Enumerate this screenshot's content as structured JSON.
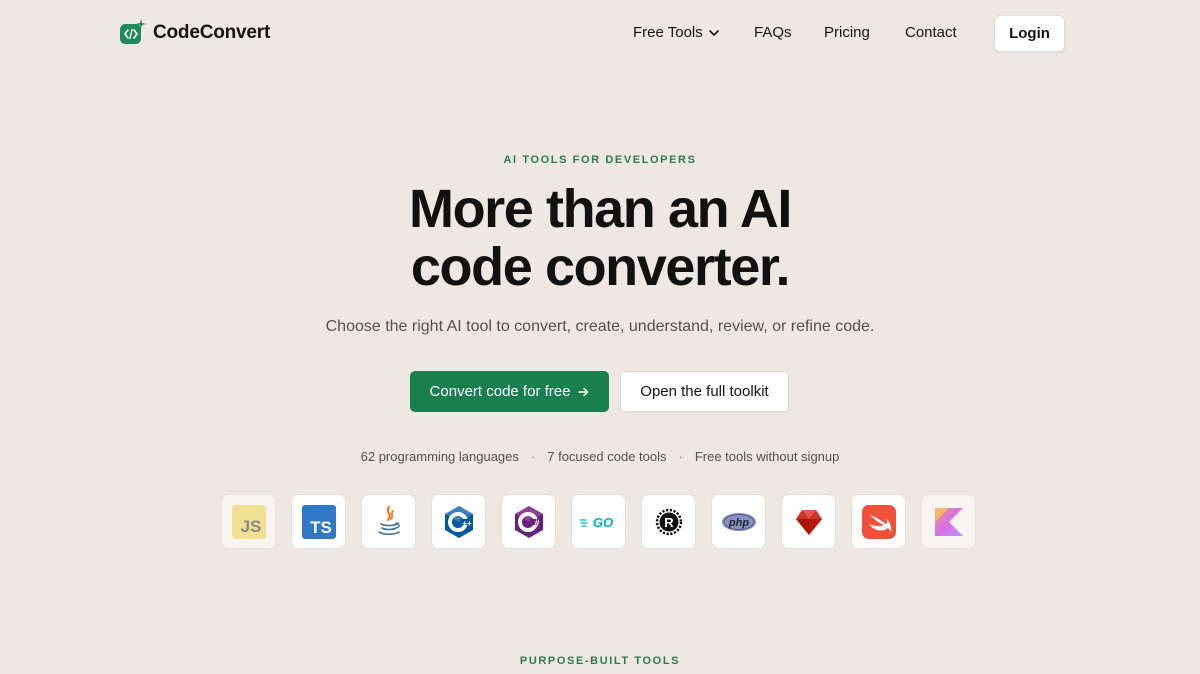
{
  "brand": {
    "name": "CodeConvert",
    "logo_icon": "code-brackets-icon",
    "accent": "#1f8a5b"
  },
  "nav": {
    "items": [
      {
        "label": "Free Tools",
        "has_dropdown": true
      },
      {
        "label": "FAQs"
      },
      {
        "label": "Pricing"
      },
      {
        "label": "Contact"
      }
    ],
    "login_label": "Login"
  },
  "hero": {
    "eyebrow": "AI TOOLS FOR DEVELOPERS",
    "title_line1": "More than an AI",
    "title_line2": "code converter.",
    "subtitle": "Choose the right AI tool to convert, create, understand, review, or refine code.",
    "primary_cta": "Convert code for free",
    "primary_cta_icon": "arrow-right-icon",
    "secondary_cta": "Open the full toolkit",
    "primary_color": "#1a7f4f"
  },
  "stats": [
    "62 programming languages",
    "7 focused code tools",
    "Free tools without signup"
  ],
  "languages": [
    {
      "name": "javascript",
      "badge": "JS"
    },
    {
      "name": "typescript",
      "badge": "TS"
    },
    {
      "name": "java"
    },
    {
      "name": "cpp",
      "badge": "C++"
    },
    {
      "name": "csharp",
      "badge": "C#"
    },
    {
      "name": "go",
      "badge": "GO"
    },
    {
      "name": "rust",
      "badge": "R"
    },
    {
      "name": "php",
      "badge": "php"
    },
    {
      "name": "ruby"
    },
    {
      "name": "swift"
    },
    {
      "name": "kotlin"
    }
  ],
  "next_section": {
    "label": "PURPOSE-BUILT TOOLS"
  }
}
